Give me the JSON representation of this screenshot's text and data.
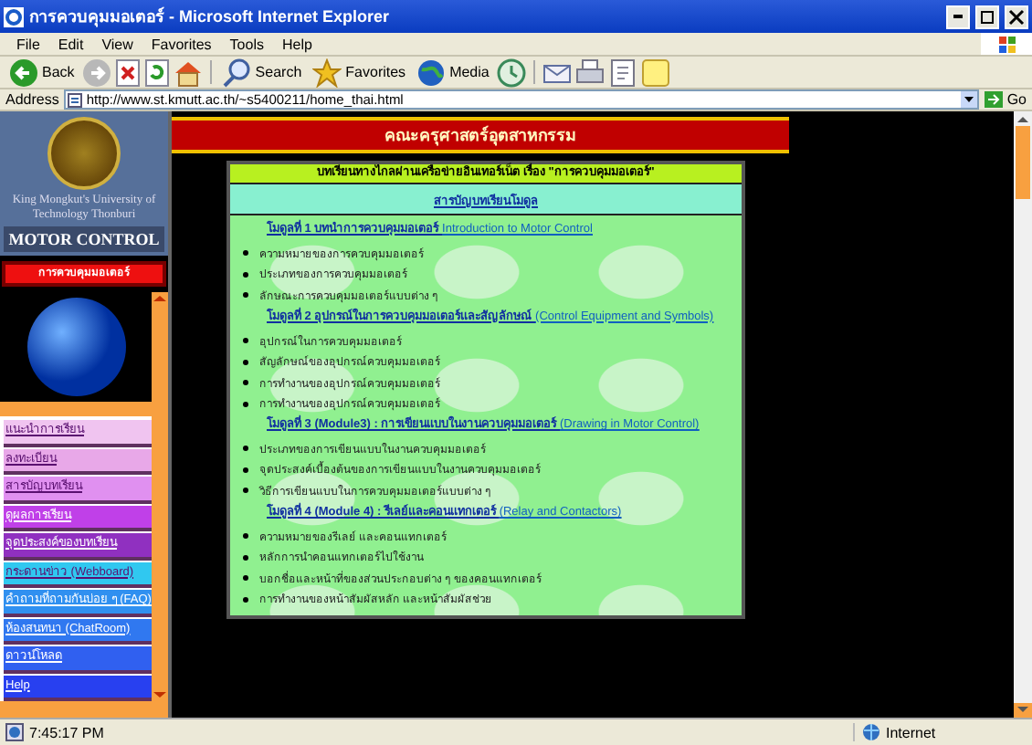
{
  "window": {
    "title": "การควบคุมมอเตอร์ - Microsoft Internet Explorer"
  },
  "menu": [
    "File",
    "Edit",
    "View",
    "Favorites",
    "Tools",
    "Help"
  ],
  "toolbar": [
    {
      "kind": "back",
      "label": "Back"
    },
    {
      "kind": "forward"
    },
    {
      "kind": "stop"
    },
    {
      "kind": "refresh"
    },
    {
      "kind": "home"
    },
    {
      "kind": "search",
      "label": "Search"
    },
    {
      "kind": "favorites",
      "label": "Favorites"
    },
    {
      "kind": "media",
      "label": "Media"
    },
    {
      "kind": "history"
    },
    {
      "kind": "mail"
    },
    {
      "kind": "print"
    },
    {
      "kind": "edit"
    },
    {
      "kind": "note"
    }
  ],
  "address": {
    "label": "Address",
    "value": "http://www.st.kmutt.ac.th/~s5400211/home_thai.html",
    "go": "Go"
  },
  "sidebar": {
    "university": "King Mongkut's University of Technology Thonburi",
    "course": "MOTOR CONTROL",
    "banner": "การควบคุมมอเตอร์",
    "items": [
      {
        "label": "แนะนำการเรียน",
        "color": "#f0c4f0"
      },
      {
        "label": "ลงทะเบียน",
        "color": "#e8a8e8"
      },
      {
        "label": "สารบัญบทเรียน",
        "color": "#e090f0"
      },
      {
        "label": "ดูผลการเรียน",
        "color": "#c040e8"
      },
      {
        "label": "จุดประสงค์ของบทเรียน",
        "color": "#9030c0"
      },
      {
        "label": "กระดานข่าว (Webboard)",
        "color": "#30c8f0"
      },
      {
        "label": "คำถามที่ถามกันบ่อย ๆ (FAQ)",
        "color": "#3090f0"
      },
      {
        "label": "ห้องสนทนา (ChatRoom)",
        "color": "#3078f0"
      },
      {
        "label": "ดาวน์โหลด",
        "color": "#3060f0"
      },
      {
        "label": "Help",
        "color": "#2840f0"
      }
    ]
  },
  "page": {
    "faculty": "คณะครุศาสตร์อุตสาหกรรม",
    "lesson_title": "บทเรียนทางไกลผ่านเครือข่ายอินเทอร์เน็ต เรื่อง \"การควบคุมมอเตอร์\"",
    "contents_link": "สารบัญบทเรียนโมดูล",
    "modules": [
      {
        "title": "โมดูลที่ 1 บทนำการควบคุมมอเตอร์",
        "english": "Introduction to Motor Control",
        "topics": [
          "ความหมายของการควบคุมมอเตอร์",
          "ประเภทของการควบคุมมอเตอร์",
          "ลักษณะการควบคุมมอเตอร์แบบต่าง ๆ"
        ]
      },
      {
        "title": "โมดูลที่ 2 อุปกรณ์ในการควบคุมมอเตอร์และสัญลักษณ์",
        "english": "(Control Equipment and Symbols)",
        "topics": [
          "อุปกรณ์ในการควบคุมมอเตอร์",
          "สัญลักษณ์ของอุปกรณ์ควบคุมมอเตอร์",
          "การทำงานของอุปกรณ์ควบคุมมอเตอร์",
          "การทำงานของอุปกรณ์ควบคุมมอเตอร์"
        ]
      },
      {
        "title": "โมดูลที่ 3 (Module3) : การเขียนแบบในงานควบคุมมอเตอร์",
        "english": "(Drawing in Motor Control)",
        "topics": [
          "ประเภทของการเขียนแบบในงานควบคุมมอเตอร์",
          "จุดประสงค์เบื้องต้นของการเขียนแบบในงานควบคุมมอเตอร์",
          "วิธีการเขียนแบบในการควบคุมมอเตอร์แบบต่าง ๆ"
        ]
      },
      {
        "title": "โมดูลที่ 4 (Module 4) : รีเลย์และคอนแทกเตอร์",
        "english": "(Relay and Contactors)",
        "topics": [
          "ความหมายของรีเลย์ และคอนแทกเตอร์",
          "หลักการนำคอนแทกเตอร์ไปใช้งาน",
          "บอกชื่อและหน้าที่ของส่วนประกอบต่าง ๆ ของคอนแทกเตอร์",
          "การทำงานของหน้าสัมผัสหลัก และหน้าสัมผัสช่วย"
        ]
      }
    ]
  },
  "status_bar": {
    "time": "7:45:17 PM",
    "zone": "Internet"
  }
}
